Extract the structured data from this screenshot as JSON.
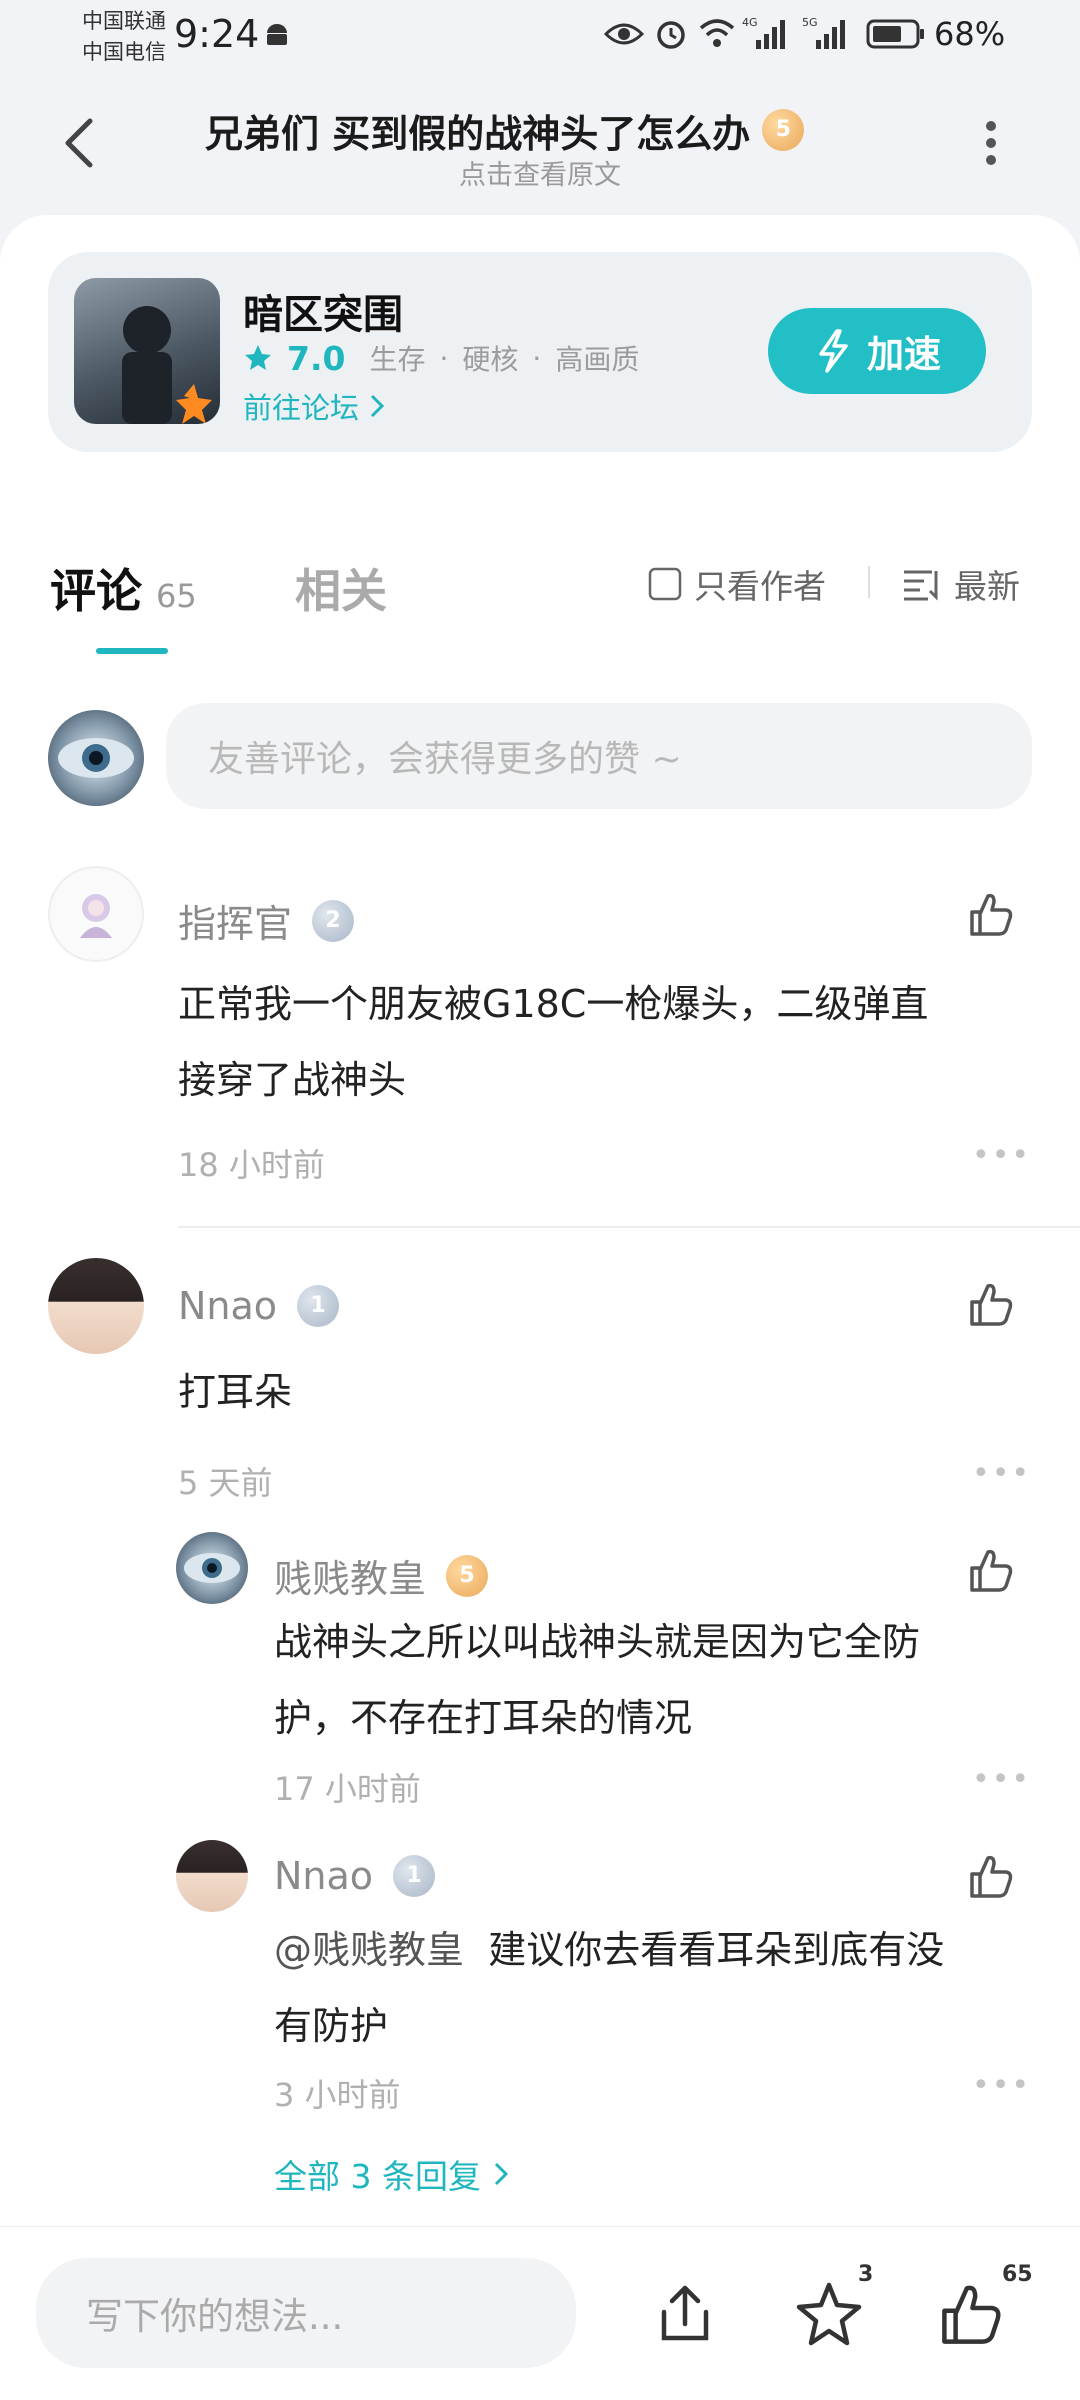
{
  "status_bar": {
    "carrier1": "中国联通",
    "carrier2": "中国电信",
    "time": "9:24",
    "battery": "68%"
  },
  "header": {
    "title": "兄弟们 买到假的战神头了怎么办",
    "title_level": "5",
    "subtitle": "点击查看原文"
  },
  "game": {
    "name": "暗区突围",
    "rating": "7.0",
    "tags": [
      "生存",
      "硬核",
      "高画质"
    ],
    "forum_link": "前往论坛",
    "accelerate_label": "加速"
  },
  "tabs": {
    "comments_label": "评论",
    "comments_count": "65",
    "related_label": "相关",
    "author_only_label": "只看作者",
    "sort_label": "最新"
  },
  "comment_input": {
    "placeholder": "友善评论，会获得更多的赞 ~"
  },
  "comments": [
    {
      "user": "指挥官",
      "level": "2",
      "text": "正常我一个朋友被G18C一枪爆头，二级弹直接穿了战神头",
      "line1": "正常我一个朋友被G18C一枪爆头，二级弹直",
      "line2": "接穿了战神头",
      "time": "18 小时前"
    },
    {
      "user": "Nnao",
      "level": "1",
      "text": "打耳朵",
      "time": "5 天前",
      "replies": [
        {
          "user": "贱贱教皇",
          "level": "5",
          "line1": "战神头之所以叫战神头就是因为它全防",
          "line2": "护，不存在打耳朵的情况",
          "time": "17 小时前"
        },
        {
          "user": "Nnao",
          "level": "1",
          "mention": "@贱贱教皇",
          "line1": "建议你去看看耳朵到底有没",
          "line2": "有防护",
          "time": "3 小时前"
        }
      ],
      "all_replies": "全部 3 条回复"
    }
  ],
  "bottom_bar": {
    "write_placeholder": "写下你的想法...",
    "favorite_count": "3",
    "like_count": "65"
  },
  "colors": {
    "accent": "#22bfc7",
    "gold_level": "#e9a85a",
    "silver_level": "#a8b6c6"
  }
}
